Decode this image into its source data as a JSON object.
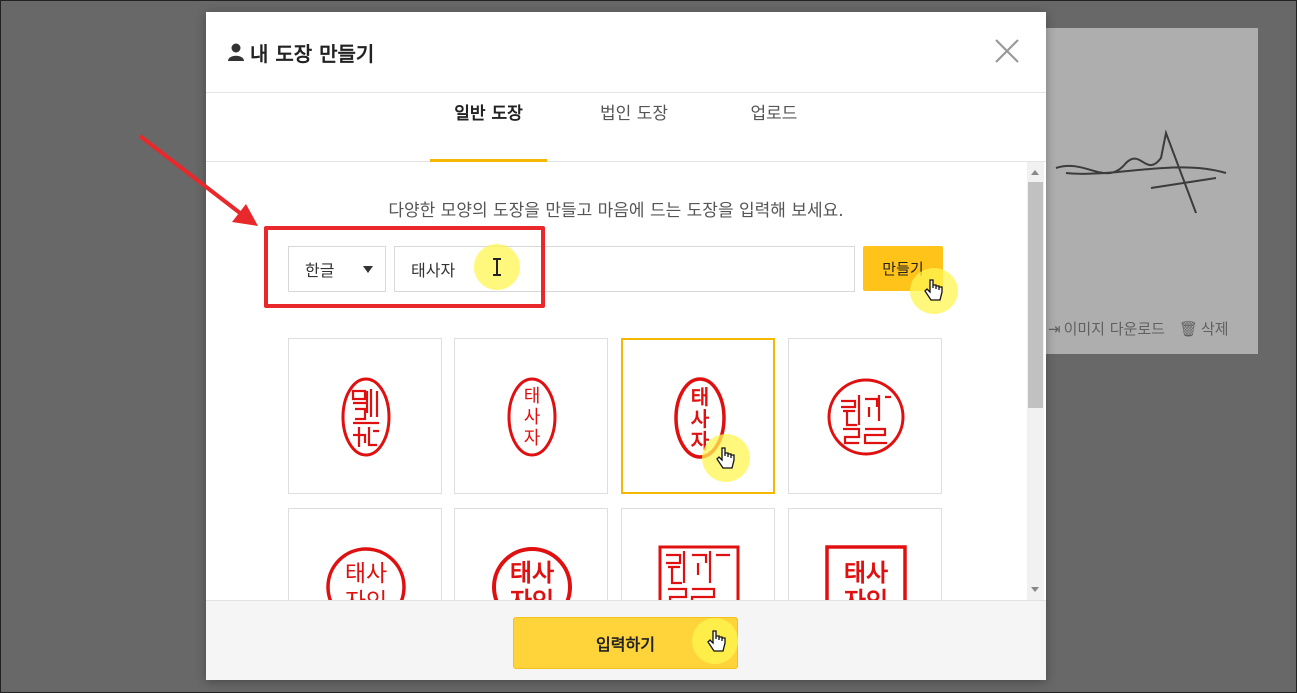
{
  "background": {
    "download_label": "이미지 다운로드",
    "delete_label": "삭제"
  },
  "modal": {
    "title": "내 도장 만들기",
    "tabs": [
      {
        "label": "일반 도장",
        "active": true
      },
      {
        "label": "법인 도장",
        "active": false
      },
      {
        "label": "업로드",
        "active": false
      }
    ],
    "description": "다양한 모양의 도장을 만들고 마음에 드는 도장을 입력해 보세요.",
    "language_select": {
      "selected": "한글"
    },
    "name_input": {
      "value": "태사자"
    },
    "make_button": "만들기",
    "submit_button": "입력하기",
    "stamps": [
      {
        "style": "oval-seal-script",
        "selected": false
      },
      {
        "style": "oval-vertical",
        "selected": false,
        "text": [
          "태",
          "사",
          "자"
        ]
      },
      {
        "style": "oval-vertical-bold",
        "selected": true,
        "text": [
          "태",
          "사",
          "자"
        ]
      },
      {
        "style": "round-seal-script",
        "selected": false
      },
      {
        "style": "round-two-line",
        "selected": false,
        "text": [
          "태사",
          "자인"
        ]
      },
      {
        "style": "round-two-line-bold",
        "selected": false,
        "text": [
          "태사",
          "자인"
        ]
      },
      {
        "style": "square-seal-script",
        "selected": false
      },
      {
        "style": "square-two-line",
        "selected": false,
        "text": [
          "태사",
          "자인"
        ]
      }
    ]
  },
  "colors": {
    "accent": "#ffc31a",
    "stamp_red": "#e01010",
    "annotation_red": "#e8282a",
    "highlight": "#fff550"
  }
}
